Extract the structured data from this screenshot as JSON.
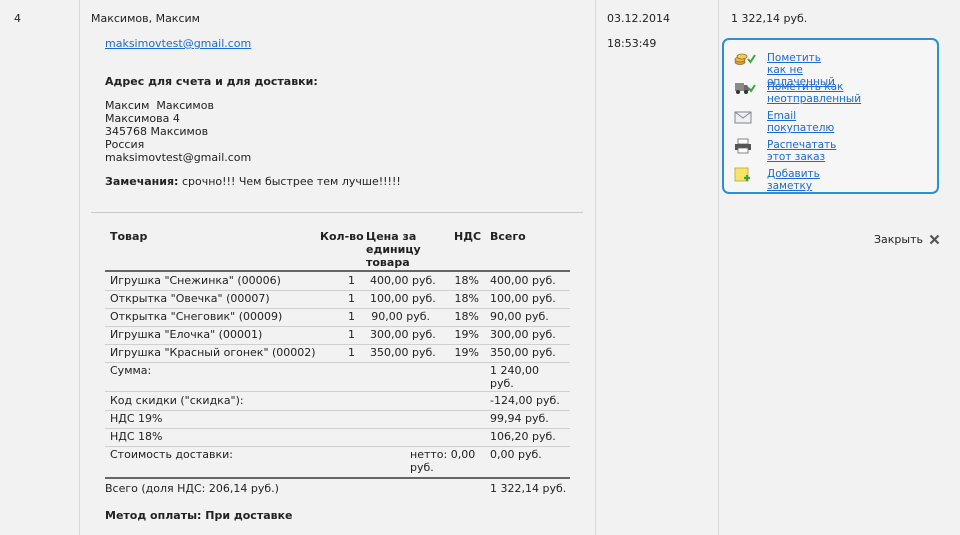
{
  "order": {
    "number": "4",
    "customer_name": "Максимов, Максим",
    "email": "maksimovtest@gmail.com",
    "date": "03.12.2014",
    "time": "18:53:49",
    "total": "1 322,14 руб."
  },
  "address": {
    "heading": "Адрес для счета и для доставки:",
    "lines": [
      "Максим  Максимов",
      "Максимова 4",
      "345768 Максимов",
      "Россия",
      "maksimovtest@gmail.com"
    ]
  },
  "remarks": {
    "label": "Замечания:",
    "text": "срочно!!! Чем быстрее тем лучше!!!!!"
  },
  "items_table": {
    "headers": {
      "product": "Товар",
      "qty": "Кол-во",
      "unit_price": "Цена за единицу товара",
      "vat": "НДС",
      "total": "Всего"
    },
    "rows": [
      {
        "name": "Игрушка \"Снежинка\" (00006)",
        "qty": "1",
        "price": "400,00 руб.",
        "vat": "18%",
        "total": "400,00 руб."
      },
      {
        "name": "Открытка \"Овечка\" (00007)",
        "qty": "1",
        "price": "100,00 руб.",
        "vat": "18%",
        "total": "100,00 руб."
      },
      {
        "name": "Открытка \"Снеговик\" (00009)",
        "qty": "1",
        "price": "90,00 руб.",
        "vat": "18%",
        "total": "90,00 руб."
      },
      {
        "name": "Игрушка \"Елочка\" (00001)",
        "qty": "1",
        "price": "300,00 руб.",
        "vat": "19%",
        "total": "300,00 руб."
      },
      {
        "name": "Игрушка \"Красный огонек\" (00002)",
        "qty": "1",
        "price": "350,00 руб.",
        "vat": "19%",
        "total": "350,00 руб."
      }
    ],
    "summary": {
      "sum_label": "Сумма:",
      "sum_value": "1 240,00 руб.",
      "discount_label": "Код скидки (\"скидка\"):",
      "discount_value": "-124,00 руб.",
      "vat19_label": "НДС 19%",
      "vat19_value": "99,94 руб.",
      "vat18_label": "НДС 18%",
      "vat18_value": "106,20 руб.",
      "shipping_label": "Стоимость доставки:",
      "shipping_net": "нетто: 0,00 руб.",
      "shipping_value": "0,00 руб.",
      "grand_label": "Всего (доля НДС: 206,14 руб.)",
      "grand_value": "1 322,14 руб."
    }
  },
  "payment": {
    "label": "Метод оплаты: При доставке"
  },
  "actions": [
    {
      "label": "Пометить как не оплаченный",
      "icon": "coins-check-icon"
    },
    {
      "label": "Пометить как неотправленный",
      "icon": "truck-check-icon"
    },
    {
      "label": "Email покупателю",
      "icon": "envelope-icon"
    },
    {
      "label": "Распечатать этот заказ",
      "icon": "printer-icon"
    },
    {
      "label": "Добавить заметку",
      "icon": "note-add-icon"
    }
  ],
  "close": {
    "label": "Закрыть"
  },
  "colors": {
    "link": "#1a6ad1",
    "box_border": "#2d8fd0",
    "check": "#3aa63a"
  }
}
